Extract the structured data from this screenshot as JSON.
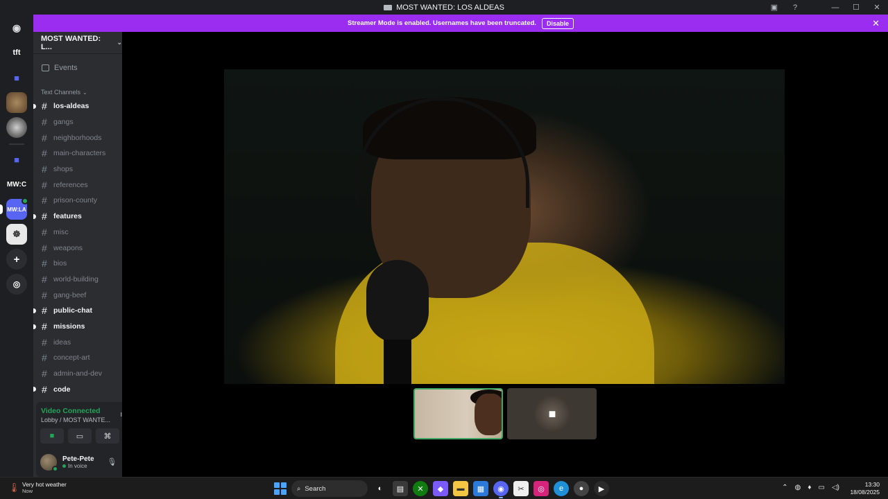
{
  "window": {
    "title": "MOST WANTED: LOS ALDEAS"
  },
  "banner": {
    "message": "Streamer Mode is enabled. Usernames have been truncated.",
    "button_label": "Disable",
    "color": "#9b2df0"
  },
  "server_rail": {
    "items": [
      {
        "name": "discord-home",
        "label": ""
      },
      {
        "name": "tft",
        "label": "tft"
      },
      {
        "name": "folder",
        "label": ""
      },
      {
        "name": "server-art",
        "label": ""
      },
      {
        "name": "server-badge",
        "label": ""
      },
      {
        "name": "folder2",
        "label": ""
      },
      {
        "name": "mw-c",
        "label": "MW:C"
      },
      {
        "name": "mw-la",
        "label": "MW:LA"
      },
      {
        "name": "server-lion",
        "label": ""
      }
    ]
  },
  "sidebar": {
    "server_name": "MOST WANTED: L...",
    "events_label": "Events",
    "category": "Text Channels",
    "channels": [
      {
        "name": "los-aldeas",
        "unread": true
      },
      {
        "name": "gangs",
        "unread": false
      },
      {
        "name": "neighborhoods",
        "unread": false
      },
      {
        "name": "main-characters",
        "unread": false
      },
      {
        "name": "shops",
        "unread": false
      },
      {
        "name": "references",
        "unread": false
      },
      {
        "name": "prison-county",
        "unread": false
      },
      {
        "name": "features",
        "unread": true
      },
      {
        "name": "misc",
        "unread": false
      },
      {
        "name": "weapons",
        "unread": false
      },
      {
        "name": "bios",
        "unread": false
      },
      {
        "name": "world-building",
        "unread": false
      },
      {
        "name": "gang-beef",
        "unread": false
      },
      {
        "name": "public-chat",
        "unread": true
      },
      {
        "name": "missions",
        "unread": true
      },
      {
        "name": "ideas",
        "unread": false
      },
      {
        "name": "concept-art",
        "unread": false
      },
      {
        "name": "admin-and-dev",
        "unread": false
      },
      {
        "name": "code",
        "unread": true
      }
    ]
  },
  "voice": {
    "status": "Video Connected",
    "location": "Lobby / MOST WANTE...",
    "user_name": "Pete-Pete",
    "user_status": "In voice"
  },
  "taskbar": {
    "weather_title": "Very hot weather",
    "weather_sub": "Now",
    "search_placeholder": "Search",
    "time": "13:30",
    "date": "18/08/2025"
  }
}
